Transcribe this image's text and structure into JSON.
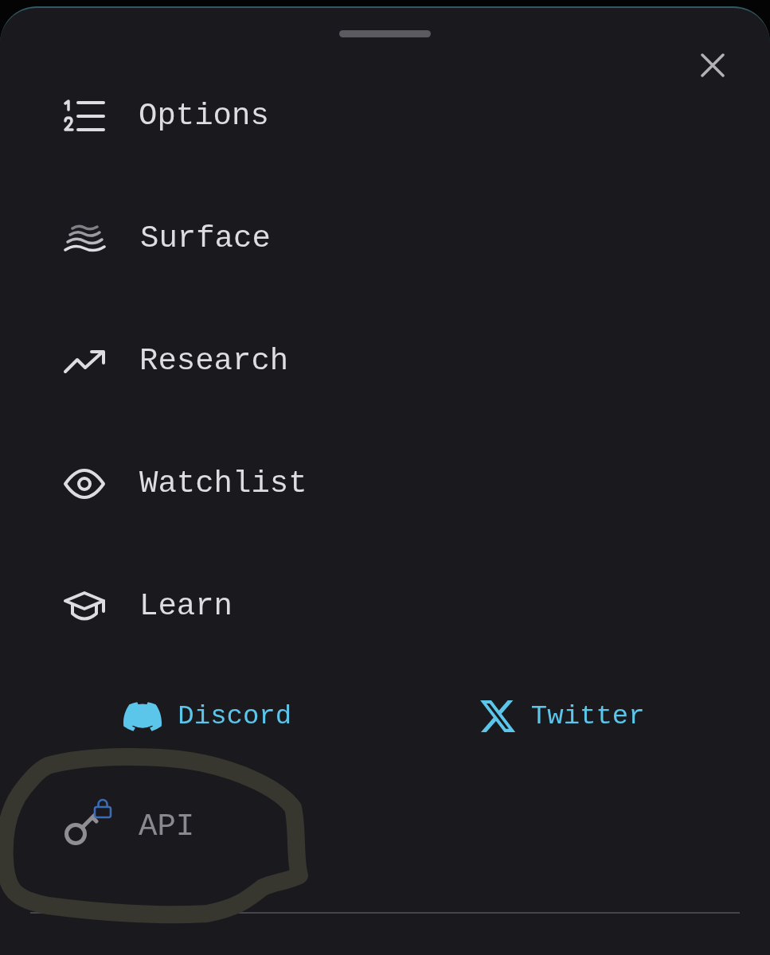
{
  "menu": [
    {
      "label": "Options",
      "kind": "numbered"
    },
    {
      "label": "Surface",
      "kind": "surface"
    },
    {
      "label": "Research",
      "kind": "trend"
    },
    {
      "label": "Watchlist",
      "kind": "eye"
    },
    {
      "label": "Learn",
      "kind": "cap"
    }
  ],
  "social_links": [
    {
      "label": "Discord",
      "kind": "discord"
    },
    {
      "label": "Twitter",
      "kind": "x"
    }
  ],
  "api_item": {
    "label": "API",
    "locked": true
  }
}
